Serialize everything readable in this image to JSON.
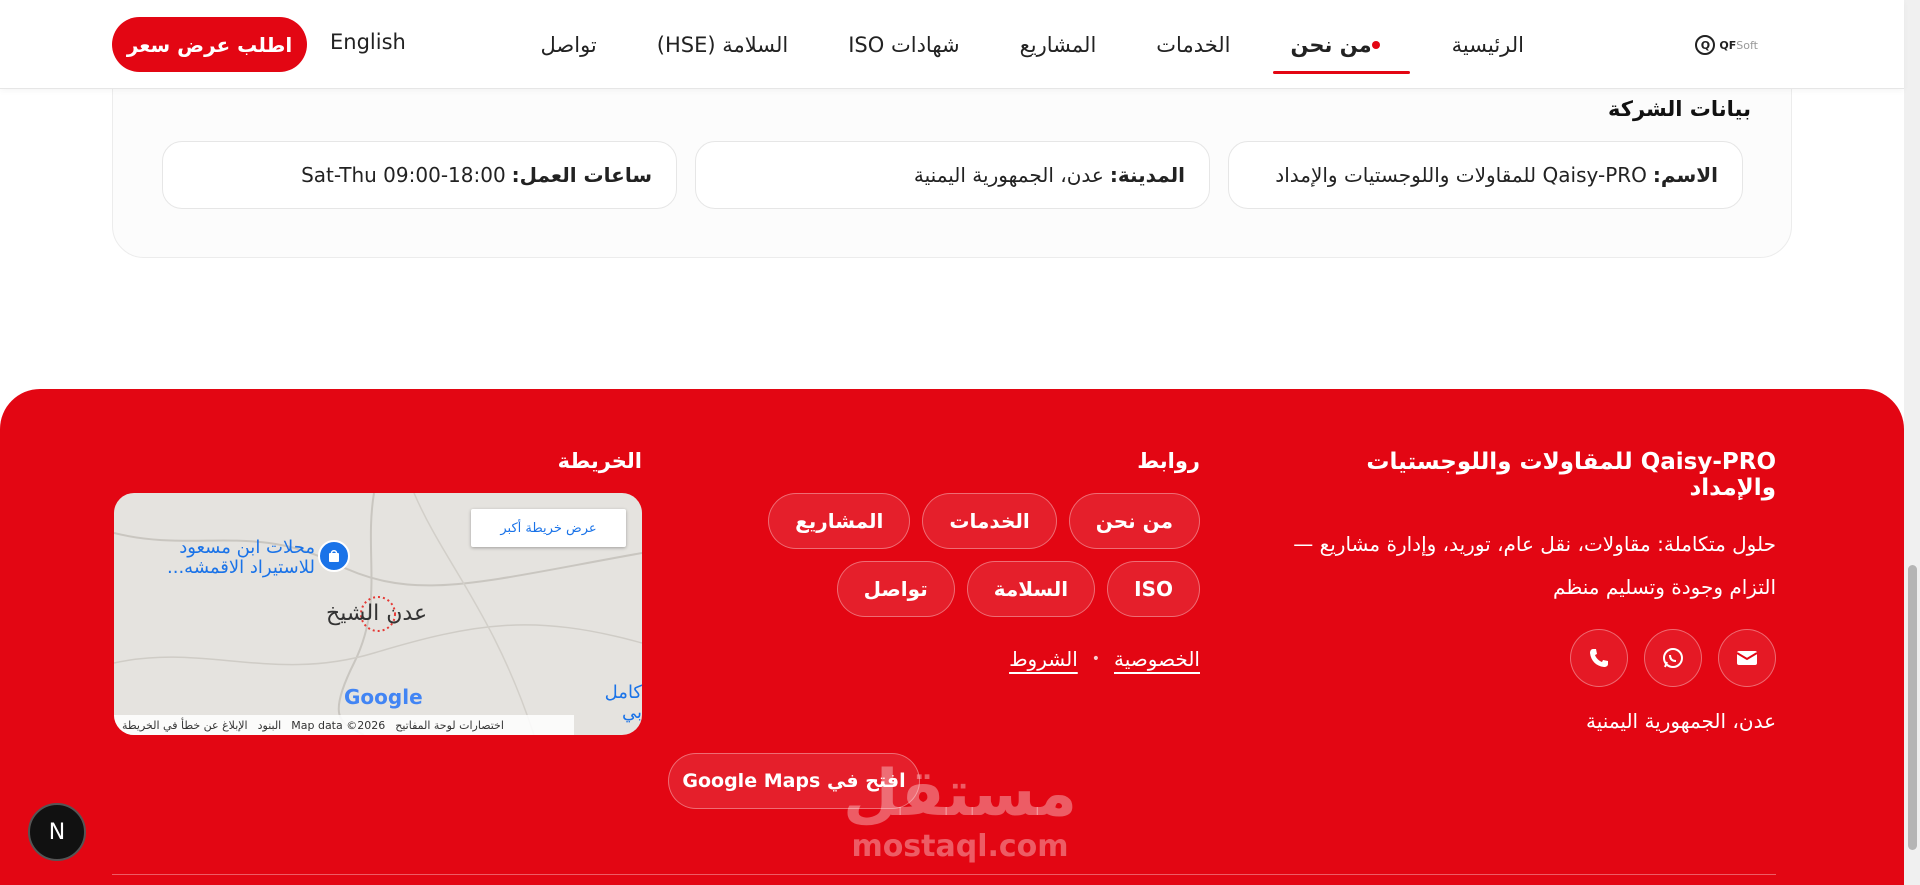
{
  "header": {
    "logo": {
      "mark": "Q",
      "text": "QF",
      "subtext": "Soft"
    },
    "nav": [
      {
        "label": "الرئيسية",
        "active": false
      },
      {
        "label": "من نحن",
        "active": true
      },
      {
        "label": "الخدمات",
        "active": false
      },
      {
        "label": "المشاريع",
        "active": false
      },
      {
        "label": "شهادات ISO",
        "active": false
      },
      {
        "label": "السلامة (HSE)",
        "active": false
      },
      {
        "label": "تواصل",
        "active": false
      }
    ],
    "language_link": "English",
    "cta_label": "اطلب عرض سعر"
  },
  "company_info": {
    "title": "بيانات الشركة",
    "name_label": "الاسم:",
    "name_value": "Qaisy-PRO للمقاولات واللوجستيات والإمداد",
    "city_label": "المدينة:",
    "city_value": "عدن، الجمهورية اليمنية",
    "hours_label": "ساعات العمل:",
    "hours_value": "Sat-Thu 09:00-18:00"
  },
  "footer": {
    "brand_title": "Qaisy-PRO للمقاولات واللوجستيات والإمداد",
    "brand_description": "حلول متكاملة: مقاولات، نقل عام، توريد، وإدارة مشاريع — التزام وجودة وتسليم منظم",
    "address": "عدن، الجمهورية اليمنية",
    "social": [
      {
        "name": "email-icon"
      },
      {
        "name": "whatsapp-icon"
      },
      {
        "name": "phone-icon"
      }
    ],
    "links_title": "روابط",
    "links": [
      "من نحن",
      "الخدمات",
      "المشاريع",
      "ISO",
      "السلامة",
      "تواصل"
    ],
    "privacy_label": "الخصوصية",
    "terms_label": "الشروط",
    "map_title": "الخريطة",
    "map": {
      "larger_map": "عرض خريطة أكبر",
      "poi_label": "محلات ابن مسعود للاستيراد الاقمشه...",
      "city_label": "عدن الشيخ",
      "side_poi": "كامل بي",
      "google_logo": "Google",
      "attribution": [
        "اختصارات لوحة المفاتيح",
        "Map data ©2026",
        "البنود",
        "الإبلاغ عن خطأ في الخريطة"
      ]
    },
    "google_maps_button": "افتح في Google Maps",
    "watermark_ar": "مستقل",
    "watermark_en": "mostaql.com"
  },
  "dev_badge": "N",
  "colors": {
    "brand_red": "#e30613",
    "link_blue": "#1a73e8"
  }
}
